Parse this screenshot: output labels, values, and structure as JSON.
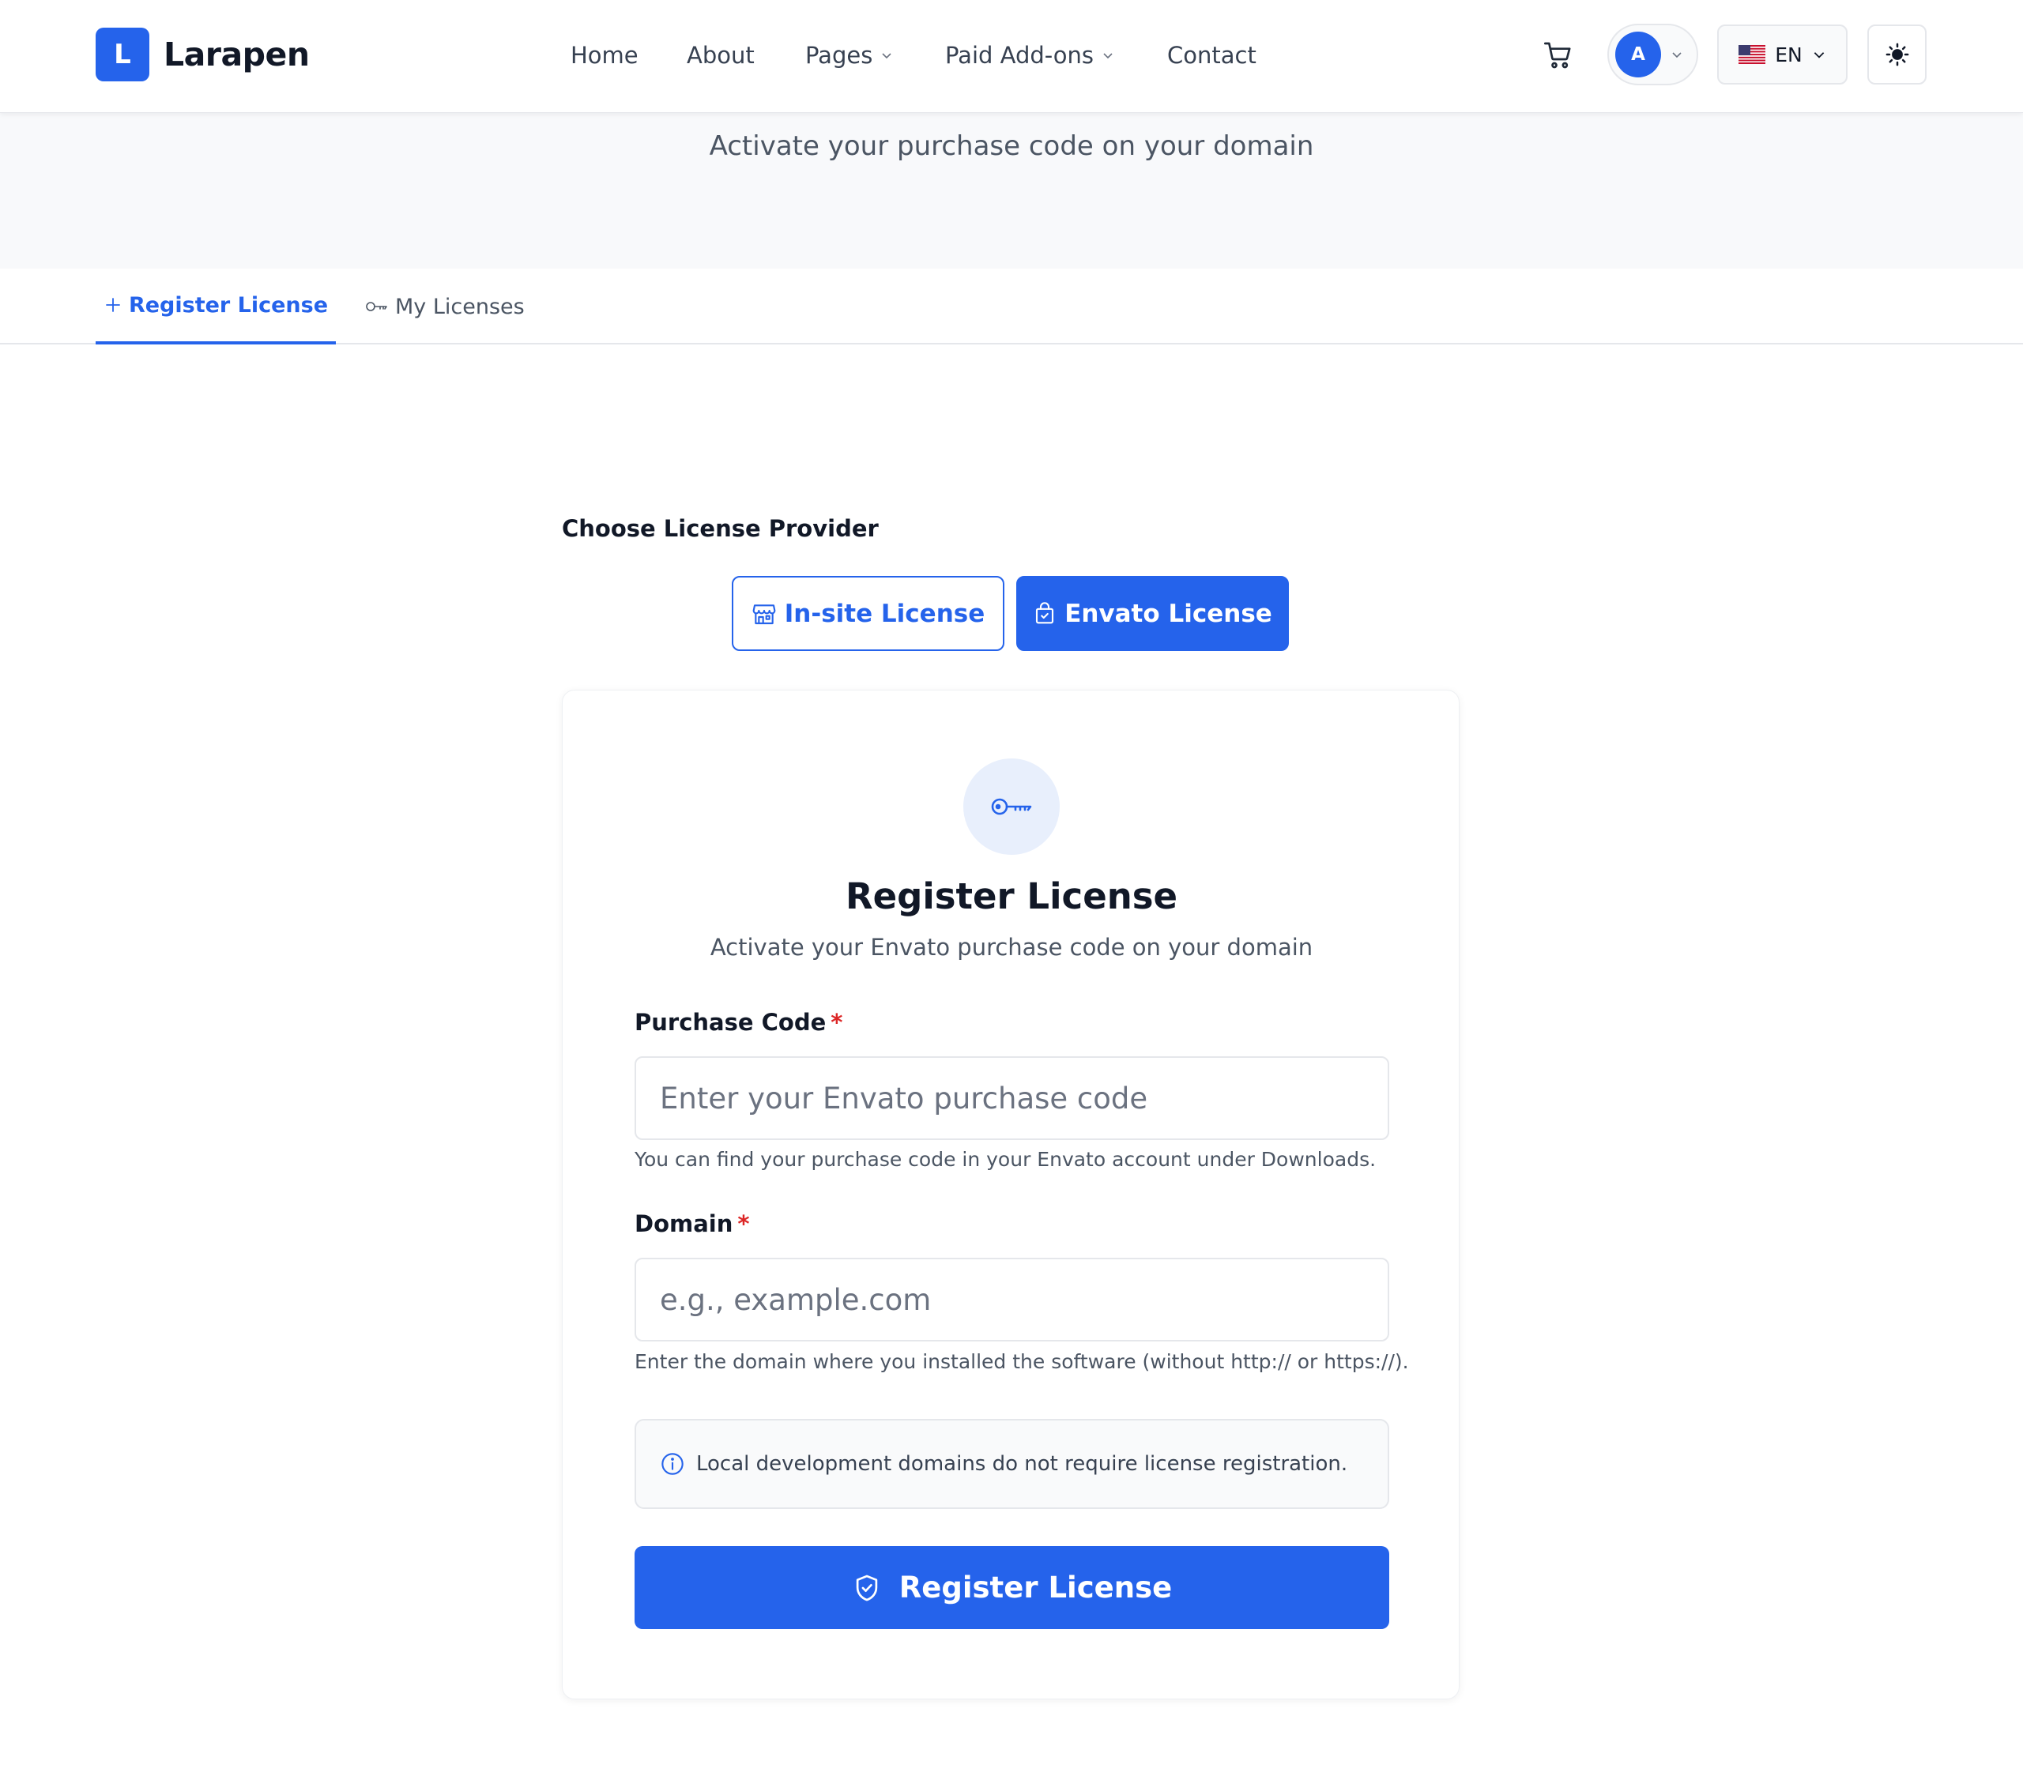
{
  "brand": {
    "logo_letter": "L",
    "name": "Larapen"
  },
  "nav": {
    "items": [
      {
        "label": "Home"
      },
      {
        "label": "About"
      },
      {
        "label": "Pages"
      },
      {
        "label": "Paid Add-ons"
      },
      {
        "label": "Contact"
      }
    ]
  },
  "user": {
    "avatar_initial": "A"
  },
  "language": {
    "code": "EN",
    "flag_icon": "us-flag-icon"
  },
  "hero": {
    "subtitle": "Activate your purchase code on your domain"
  },
  "tabs": {
    "register": "Register License",
    "my_licenses": "My Licenses"
  },
  "provider": {
    "label": "Choose License Provider",
    "insite": "In-site License",
    "envato": "Envato License",
    "selected": "Envato License"
  },
  "form": {
    "title": "Register License",
    "subtitle": "Activate your Envato purchase code on your domain",
    "purchase_code": {
      "label": "Purchase Code",
      "required_mark": "*",
      "placeholder": "Enter your Envato purchase code",
      "value": "",
      "help": "You can find your purchase code in your Envato account under Downloads."
    },
    "domain": {
      "label": "Domain",
      "required_mark": "*",
      "placeholder": "e.g., example.com",
      "value": "",
      "help": "Enter the domain where you installed the software (without http:// or https://)."
    },
    "note": "Local development domains do not require license registration.",
    "submit": "Register License"
  },
  "colors": {
    "primary": "#2563eb",
    "required": "#dc2626",
    "hero_bg": "#f8f9fb",
    "key_circle_bg": "#e8effc"
  }
}
